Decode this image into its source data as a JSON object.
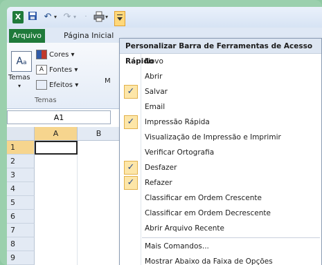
{
  "quick_access_toolbar": {
    "excel_logo": "X",
    "icons": [
      "excel-icon",
      "save-icon",
      "undo-icon",
      "redo-icon",
      "print-icon",
      "customize-arrow-icon"
    ]
  },
  "ribbon": {
    "tabs": [
      {
        "label": "Arquivo"
      },
      {
        "label": "Página Inicial"
      }
    ],
    "temas_button": "Temas",
    "cores_label": "Cores",
    "fontes_label": "Fontes",
    "efeitos_label": "Efeitos",
    "temas_group_label": "Temas",
    "truncated_label": "M"
  },
  "sheet": {
    "name_box": "A1",
    "columns": [
      "A",
      "B"
    ],
    "rows": [
      "1",
      "2",
      "3",
      "4",
      "5",
      "6",
      "7",
      "8",
      "9"
    ]
  },
  "menu": {
    "title": "Personalizar Barra de Ferramentas de Acesso Rápido",
    "items": [
      {
        "label": "Novo",
        "checked": false
      },
      {
        "label": "Abrir",
        "checked": false
      },
      {
        "label": "Salvar",
        "checked": true
      },
      {
        "label": "Email",
        "checked": false
      },
      {
        "label": "Impressão Rápida",
        "checked": true
      },
      {
        "label": "Visualização de Impressão e Imprimir",
        "checked": false
      },
      {
        "label": "Verificar Ortografia",
        "checked": false
      },
      {
        "label": "Desfazer",
        "checked": true
      },
      {
        "label": "Refazer",
        "checked": true
      },
      {
        "label": "Classificar em Ordem Crescente",
        "checked": false
      },
      {
        "label": "Classificar em Ordem Decrescente",
        "checked": false
      },
      {
        "label": "Abrir Arquivo Recente",
        "checked": false
      },
      {
        "label": "Mais Comandos...",
        "checked": false
      },
      {
        "label": "Mostrar Abaixo da Faixa de Opções",
        "checked": false
      }
    ],
    "check_glyph": "✓"
  },
  "colors": {
    "excel_green": "#1f7a3a",
    "frame_green": "#9bd0ad",
    "selection_orange": "#f6d58e"
  }
}
